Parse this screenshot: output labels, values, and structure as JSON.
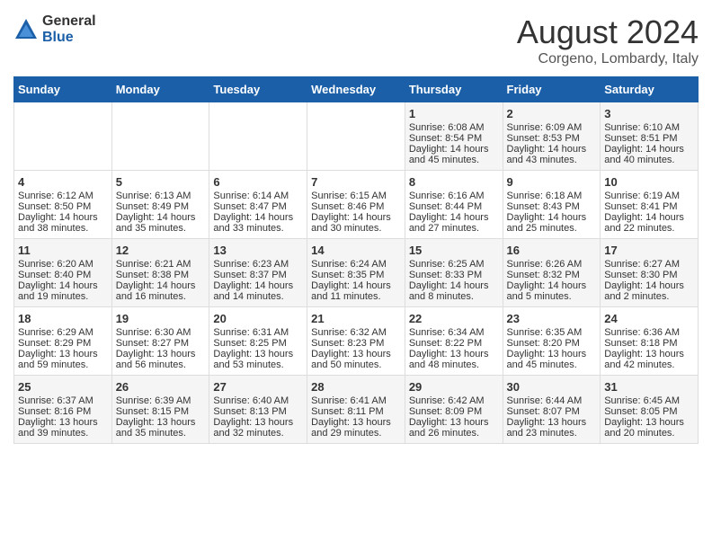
{
  "logo": {
    "general": "General",
    "blue": "Blue"
  },
  "title": "August 2024",
  "subtitle": "Corgeno, Lombardy, Italy",
  "weekdays": [
    "Sunday",
    "Monday",
    "Tuesday",
    "Wednesday",
    "Thursday",
    "Friday",
    "Saturday"
  ],
  "weeks": [
    [
      {
        "day": "",
        "info": ""
      },
      {
        "day": "",
        "info": ""
      },
      {
        "day": "",
        "info": ""
      },
      {
        "day": "",
        "info": ""
      },
      {
        "day": "1",
        "info": "Sunrise: 6:08 AM\nSunset: 8:54 PM\nDaylight: 14 hours and 45 minutes."
      },
      {
        "day": "2",
        "info": "Sunrise: 6:09 AM\nSunset: 8:53 PM\nDaylight: 14 hours and 43 minutes."
      },
      {
        "day": "3",
        "info": "Sunrise: 6:10 AM\nSunset: 8:51 PM\nDaylight: 14 hours and 40 minutes."
      }
    ],
    [
      {
        "day": "4",
        "info": "Sunrise: 6:12 AM\nSunset: 8:50 PM\nDaylight: 14 hours and 38 minutes."
      },
      {
        "day": "5",
        "info": "Sunrise: 6:13 AM\nSunset: 8:49 PM\nDaylight: 14 hours and 35 minutes."
      },
      {
        "day": "6",
        "info": "Sunrise: 6:14 AM\nSunset: 8:47 PM\nDaylight: 14 hours and 33 minutes."
      },
      {
        "day": "7",
        "info": "Sunrise: 6:15 AM\nSunset: 8:46 PM\nDaylight: 14 hours and 30 minutes."
      },
      {
        "day": "8",
        "info": "Sunrise: 6:16 AM\nSunset: 8:44 PM\nDaylight: 14 hours and 27 minutes."
      },
      {
        "day": "9",
        "info": "Sunrise: 6:18 AM\nSunset: 8:43 PM\nDaylight: 14 hours and 25 minutes."
      },
      {
        "day": "10",
        "info": "Sunrise: 6:19 AM\nSunset: 8:41 PM\nDaylight: 14 hours and 22 minutes."
      }
    ],
    [
      {
        "day": "11",
        "info": "Sunrise: 6:20 AM\nSunset: 8:40 PM\nDaylight: 14 hours and 19 minutes."
      },
      {
        "day": "12",
        "info": "Sunrise: 6:21 AM\nSunset: 8:38 PM\nDaylight: 14 hours and 16 minutes."
      },
      {
        "day": "13",
        "info": "Sunrise: 6:23 AM\nSunset: 8:37 PM\nDaylight: 14 hours and 14 minutes."
      },
      {
        "day": "14",
        "info": "Sunrise: 6:24 AM\nSunset: 8:35 PM\nDaylight: 14 hours and 11 minutes."
      },
      {
        "day": "15",
        "info": "Sunrise: 6:25 AM\nSunset: 8:33 PM\nDaylight: 14 hours and 8 minutes."
      },
      {
        "day": "16",
        "info": "Sunrise: 6:26 AM\nSunset: 8:32 PM\nDaylight: 14 hours and 5 minutes."
      },
      {
        "day": "17",
        "info": "Sunrise: 6:27 AM\nSunset: 8:30 PM\nDaylight: 14 hours and 2 minutes."
      }
    ],
    [
      {
        "day": "18",
        "info": "Sunrise: 6:29 AM\nSunset: 8:29 PM\nDaylight: 13 hours and 59 minutes."
      },
      {
        "day": "19",
        "info": "Sunrise: 6:30 AM\nSunset: 8:27 PM\nDaylight: 13 hours and 56 minutes."
      },
      {
        "day": "20",
        "info": "Sunrise: 6:31 AM\nSunset: 8:25 PM\nDaylight: 13 hours and 53 minutes."
      },
      {
        "day": "21",
        "info": "Sunrise: 6:32 AM\nSunset: 8:23 PM\nDaylight: 13 hours and 50 minutes."
      },
      {
        "day": "22",
        "info": "Sunrise: 6:34 AM\nSunset: 8:22 PM\nDaylight: 13 hours and 48 minutes."
      },
      {
        "day": "23",
        "info": "Sunrise: 6:35 AM\nSunset: 8:20 PM\nDaylight: 13 hours and 45 minutes."
      },
      {
        "day": "24",
        "info": "Sunrise: 6:36 AM\nSunset: 8:18 PM\nDaylight: 13 hours and 42 minutes."
      }
    ],
    [
      {
        "day": "25",
        "info": "Sunrise: 6:37 AM\nSunset: 8:16 PM\nDaylight: 13 hours and 39 minutes."
      },
      {
        "day": "26",
        "info": "Sunrise: 6:39 AM\nSunset: 8:15 PM\nDaylight: 13 hours and 35 minutes."
      },
      {
        "day": "27",
        "info": "Sunrise: 6:40 AM\nSunset: 8:13 PM\nDaylight: 13 hours and 32 minutes."
      },
      {
        "day": "28",
        "info": "Sunrise: 6:41 AM\nSunset: 8:11 PM\nDaylight: 13 hours and 29 minutes."
      },
      {
        "day": "29",
        "info": "Sunrise: 6:42 AM\nSunset: 8:09 PM\nDaylight: 13 hours and 26 minutes."
      },
      {
        "day": "30",
        "info": "Sunrise: 6:44 AM\nSunset: 8:07 PM\nDaylight: 13 hours and 23 minutes."
      },
      {
        "day": "31",
        "info": "Sunrise: 6:45 AM\nSunset: 8:05 PM\nDaylight: 13 hours and 20 minutes."
      }
    ]
  ]
}
